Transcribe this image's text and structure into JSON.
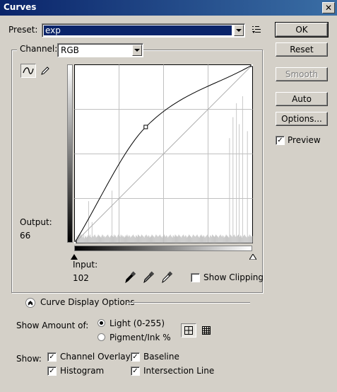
{
  "window": {
    "title": "Curves",
    "close_glyph": "✕"
  },
  "preset": {
    "label": "Preset:",
    "value": "exp",
    "menu_icon": "options-list-icon"
  },
  "channel": {
    "label": "Channel:",
    "value": "RGB"
  },
  "buttons": {
    "ok": "OK",
    "reset": "Reset",
    "smooth": "Smooth",
    "auto": "Auto",
    "options": "Options..."
  },
  "preview": {
    "label": "Preview",
    "checked": true
  },
  "curve_tools": [
    "curve-point-icon",
    "pencil-icon"
  ],
  "output": {
    "label": "Output:",
    "value": "66"
  },
  "input": {
    "label": "Input:",
    "value": "102"
  },
  "eyedroppers": [
    "black-eyedropper-icon",
    "gray-eyedropper-icon",
    "white-eyedropper-icon"
  ],
  "show_clipping": {
    "label": "Show Clipping",
    "checked": false
  },
  "curve_display": {
    "label": "Curve Display Options",
    "icon": "collapse-chevron-icon"
  },
  "show_amount": {
    "label": "Show Amount of:",
    "light": "Light  (0-255)",
    "pigment": "Pigment/Ink %",
    "selected": "light",
    "grid_icons": [
      "simple-grid-icon",
      "detailed-grid-icon"
    ]
  },
  "show": {
    "label": "Show:",
    "channel_overlays": "Channel Overlays",
    "baseline": "Baseline",
    "histogram": "Histogram",
    "intersection_line": "Intersection Line"
  },
  "colors": {
    "title_start": "#0a246a",
    "title_end": "#3a6ea5",
    "selection": "#0a246a",
    "face": "#d4d0c8"
  },
  "curve": {
    "points": [
      [
        0,
        0
      ],
      [
        102,
        166
      ],
      [
        255,
        255
      ]
    ],
    "histogram": [
      4,
      6,
      5,
      10,
      8,
      12,
      9,
      14,
      11,
      13,
      9,
      10,
      8,
      12,
      7,
      9,
      10,
      8,
      9,
      11,
      60,
      10,
      12,
      9,
      8,
      30,
      10,
      9,
      11,
      12,
      10,
      8,
      9,
      10,
      12,
      11,
      10,
      9,
      8,
      10,
      12,
      11,
      9,
      10,
      8,
      9,
      10,
      11,
      12,
      10,
      9,
      8,
      10,
      11,
      75,
      10,
      9,
      12,
      10,
      11,
      9,
      8,
      10,
      12,
      11,
      10,
      9,
      12,
      10,
      11,
      9,
      10,
      8,
      9,
      11,
      10,
      12,
      10,
      9,
      11,
      10,
      8,
      9,
      10,
      11,
      12,
      10,
      9,
      8,
      11,
      10,
      9,
      12,
      11,
      10,
      9,
      10,
      12,
      11,
      10,
      9,
      8,
      10,
      11,
      12,
      10,
      9,
      11,
      10,
      8,
      9,
      10,
      12,
      11,
      10,
      9,
      8,
      10,
      12,
      11,
      10,
      9,
      10,
      11,
      12,
      10,
      9,
      8,
      10,
      11,
      12,
      10,
      9,
      11,
      10,
      8,
      9,
      10,
      11,
      12,
      10,
      9,
      8,
      11,
      10,
      9,
      12,
      11,
      10,
      9,
      10,
      12,
      11,
      10,
      9,
      8,
      10,
      11,
      12,
      10,
      9,
      11,
      10,
      8,
      9,
      10,
      12,
      11,
      10,
      9,
      8,
      10,
      12,
      11,
      10,
      9,
      10,
      11,
      12,
      10,
      9,
      8,
      10,
      11,
      12,
      10,
      9,
      11,
      10,
      8,
      9,
      10,
      11,
      12,
      10,
      9,
      8,
      11,
      10,
      9,
      12,
      11,
      10,
      9,
      10,
      12,
      11,
      10,
      9,
      8,
      10,
      11,
      12,
      10,
      9,
      11,
      10,
      8,
      9,
      10,
      12,
      11,
      10,
      9,
      8,
      150,
      12,
      11,
      10,
      9,
      180,
      11,
      12,
      10,
      9,
      200,
      10,
      11,
      12,
      170,
      9,
      11,
      10,
      8,
      210,
      10,
      11,
      12,
      10,
      9,
      8,
      160,
      10,
      9,
      12,
      11,
      10,
      9,
      10
    ]
  }
}
